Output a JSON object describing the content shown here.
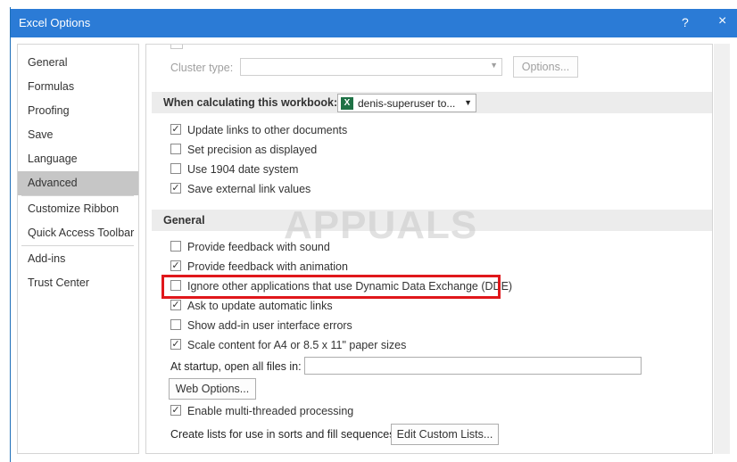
{
  "window": {
    "title": "Excel Options",
    "help": "?",
    "close": "×"
  },
  "nav": {
    "items": [
      {
        "label": "General"
      },
      {
        "label": "Formulas"
      },
      {
        "label": "Proofing"
      },
      {
        "label": "Save"
      },
      {
        "label": "Language"
      },
      {
        "label": "Advanced",
        "selected": true
      },
      {
        "label": "Customize Ribbon"
      },
      {
        "label": "Quick Access Toolbar"
      },
      {
        "label": "Add-ins"
      },
      {
        "label": "Trust Center"
      }
    ]
  },
  "top": {
    "cluster_label": "Cluster type:",
    "cluster_value": "",
    "options_button": "Options..."
  },
  "workbook_section": {
    "header": "When calculating this workbook:",
    "workbook_value": "denis-superuser to...",
    "checkboxes": [
      {
        "label": "Update links to other documents",
        "checked": true
      },
      {
        "label": "Set precision as displayed",
        "checked": false
      },
      {
        "label": "Use 1904 date system",
        "checked": false
      },
      {
        "label": "Save external link values",
        "checked": true
      }
    ]
  },
  "general_section": {
    "header": "General",
    "checkboxes": [
      {
        "label": "Provide feedback with sound",
        "checked": false
      },
      {
        "label": "Provide feedback with animation",
        "checked": true
      },
      {
        "label": "Ignore other applications that use Dynamic Data Exchange (DDE)",
        "checked": false
      },
      {
        "label": "Ask to update automatic links",
        "checked": true
      },
      {
        "label": "Show add-in user interface errors",
        "checked": false
      },
      {
        "label": "Scale content for A4 or 8.5 x 11\" paper sizes",
        "checked": true
      }
    ],
    "startup_label": "At startup, open all files in:",
    "startup_value": "",
    "web_options_button": "Web Options...",
    "multithread": {
      "label": "Enable multi-threaded processing",
      "checked": true
    },
    "custom_lists_label": "Create lists for use in sorts and fill sequences:",
    "custom_lists_button": "Edit Custom Lists..."
  },
  "watermark": "APPUALS",
  "colors": {
    "titlebar": "#2b7bd6",
    "highlight": "#e0171b",
    "selected_nav": "#c6c6c6"
  }
}
